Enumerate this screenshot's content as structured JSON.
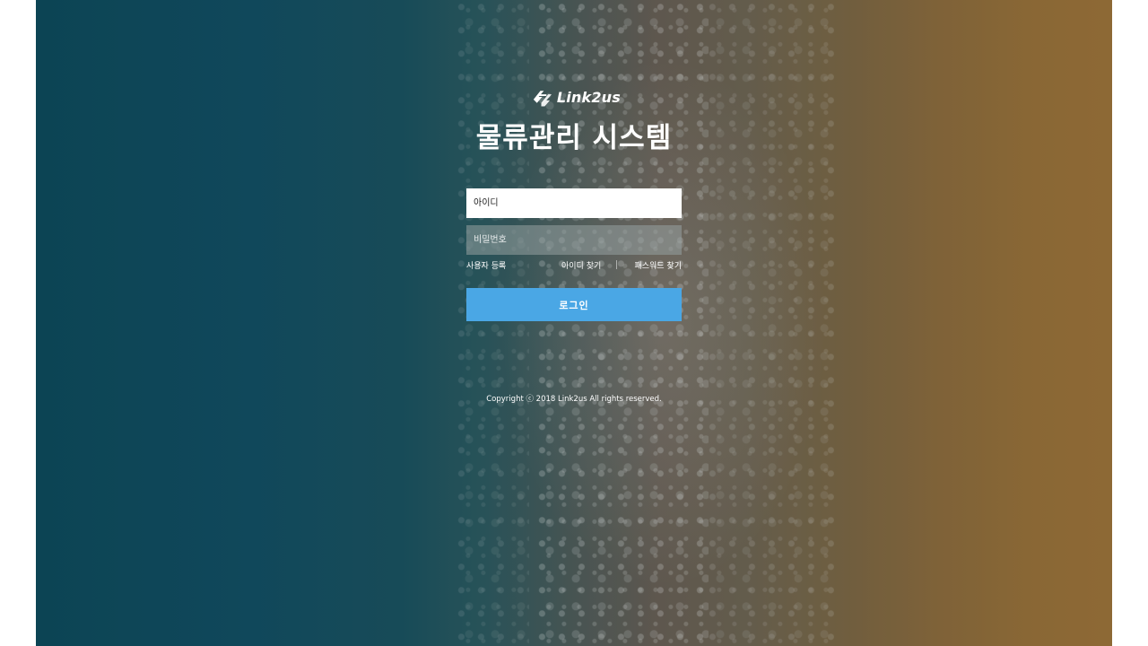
{
  "brand": {
    "logo_text": "Link2us",
    "logo_icon": "link2us-logo-icon"
  },
  "page": {
    "title": "물류관리 시스템"
  },
  "login_form": {
    "id_placeholder": "아이디",
    "password_placeholder": "비밀번호",
    "register_link": "사용자 등록",
    "find_id_link": "아이디 찾기",
    "find_password_link": "패스워드 찾기",
    "login_button": "로그인"
  },
  "footer": {
    "copyright": "Copyright ⓒ 2018 Link2us All rights reserved."
  },
  "colors": {
    "login_button": "#4aa7e5",
    "text": "#ffffff"
  }
}
